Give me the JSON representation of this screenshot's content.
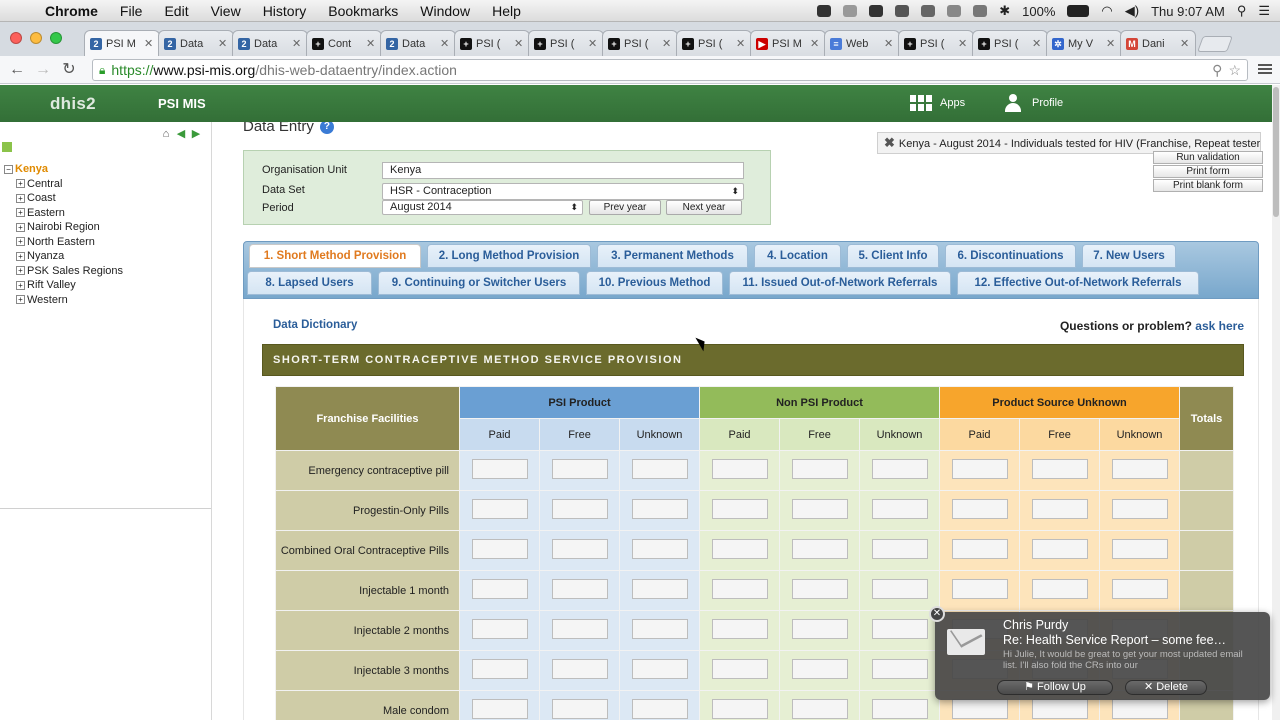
{
  "menubar": {
    "app": "Chrome",
    "items": [
      "File",
      "Edit",
      "View",
      "History",
      "Bookmarks",
      "Window",
      "Help"
    ],
    "battery": "100%",
    "clock": "Thu 9:07 AM"
  },
  "tabs": [
    {
      "label": "PSI M",
      "fav": "2",
      "fav_color": "#3465a4"
    },
    {
      "label": "Data",
      "fav": "2",
      "fav_color": "#3465a4"
    },
    {
      "label": "Data",
      "fav": "2",
      "fav_color": "#3465a4"
    },
    {
      "label": "Cont",
      "fav": "+",
      "fav_color": "#111111"
    },
    {
      "label": "Data",
      "fav": "2",
      "fav_color": "#3465a4"
    },
    {
      "label": "PSI (",
      "fav": "+",
      "fav_color": "#111111"
    },
    {
      "label": "PSI (",
      "fav": "+",
      "fav_color": "#111111"
    },
    {
      "label": "PSI (",
      "fav": "+",
      "fav_color": "#111111"
    },
    {
      "label": "PSI (",
      "fav": "+",
      "fav_color": "#111111"
    },
    {
      "label": "PSI M",
      "fav": "▶",
      "fav_color": "#cc0000"
    },
    {
      "label": "Web",
      "fav": "≡",
      "fav_color": "#4a7bd8"
    },
    {
      "label": "PSI (",
      "fav": "+",
      "fav_color": "#111111"
    },
    {
      "label": "PSI (",
      "fav": "+",
      "fav_color": "#111111"
    },
    {
      "label": "My V",
      "fav": "✲",
      "fav_color": "#3366cc"
    },
    {
      "label": "Dani",
      "fav": "M",
      "fav_color": "#d44638"
    }
  ],
  "url": {
    "scheme": "https://",
    "domain": "www.psi-mis.org",
    "path": "/dhis-web-dataentry/index.action"
  },
  "header": {
    "logo": "dhis2",
    "title": "PSI MIS",
    "apps": "Apps",
    "profile": "Profile"
  },
  "orgtree": {
    "root": "Kenya",
    "children": [
      "Central",
      "Coast",
      "Eastern",
      "Nairobi Region",
      "North Eastern",
      "Nyanza",
      "PSK Sales Regions",
      "Rift Valley",
      "Western"
    ]
  },
  "page": {
    "title": "Data Entry",
    "help": "?"
  },
  "selection": {
    "org_unit_label": "Organisation Unit",
    "org_unit_value": "Kenya",
    "data_set_label": "Data Set",
    "data_set_value": "HSR - Contraception",
    "period_label": "Period",
    "period_value": "August 2014",
    "prev_year": "Prev year",
    "next_year": "Next year"
  },
  "context_banner": "Kenya - August 2014 - Individuals tested for HIV (Franchise, Repeat tester)",
  "actions": {
    "run_validation": "Run validation",
    "print_form": "Print form",
    "print_blank_form": "Print blank form"
  },
  "section_tabs": [
    "1. Short Method Provision",
    "2. Long Method Provision",
    "3. Permanent Methods",
    "4. Location",
    "5. Client Info",
    "6. Discontinuations",
    "7. New Users",
    "8. Lapsed Users",
    "9. Continuing or Switcher Users",
    "10. Previous Method",
    "11. Issued Out-of-Network Referrals",
    "12. Effective Out-of-Network Referrals"
  ],
  "form": {
    "data_dictionary": "Data Dictionary",
    "questions": "Questions or problem?",
    "ask_here": "ask here",
    "section_title": "SHORT-TERM CONTRACEPTIVE METHOD SERVICE PROVISION",
    "facility_header": "Franchise Facilities",
    "totals_header": "Totals",
    "groups": [
      "PSI Product",
      "Non PSI Product",
      "Product Source Unknown"
    ],
    "subheaders": [
      "Paid",
      "Free",
      "Unknown"
    ],
    "rows": [
      "Emergency contraceptive pill",
      "Progestin-Only Pills",
      "Combined Oral Contraceptive Pills",
      "Injectable 1 month",
      "Injectable 2 months",
      "Injectable 3 months",
      "Male condom"
    ]
  },
  "notification": {
    "sender": "Chris Purdy",
    "subject": "Re: Health Service Report – some fee…",
    "body": "Hi Julie, It would be great to get your most updated email list. I'll also fold the CRs into our",
    "follow_up": "Follow Up",
    "delete": "Delete"
  }
}
